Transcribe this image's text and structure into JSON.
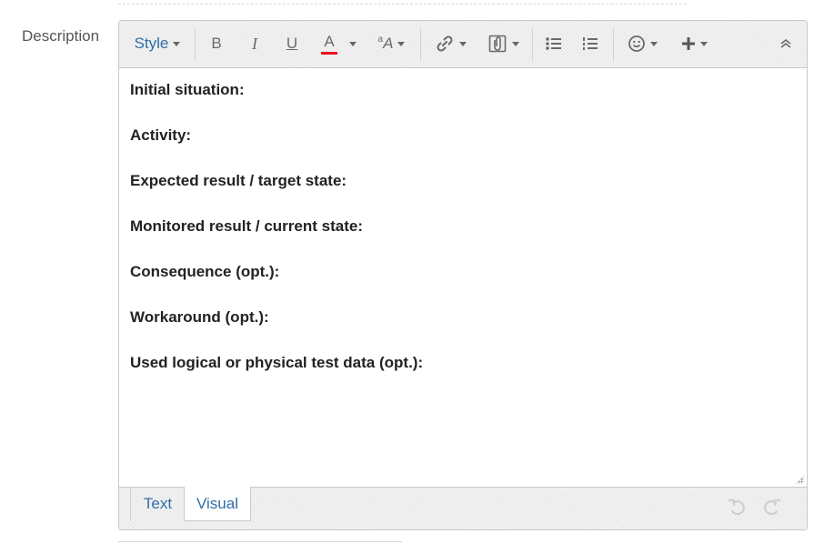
{
  "field": {
    "label": "Description"
  },
  "toolbar": {
    "style_label": "Style",
    "bold_label": "B",
    "italic_label": "I",
    "underline_label": "U",
    "font_color_label": "A",
    "font_color_accent": "#e8131d",
    "font_size_superscript": "a",
    "font_size_label": "A"
  },
  "content": {
    "lines": [
      "Initial situation:",
      "Activity:",
      "Expected result / target state:",
      "Monitored result / current state:",
      "Consequence (opt.):",
      "Workaround (opt.):",
      "Used logical or physical test data (opt.):"
    ]
  },
  "tabs": {
    "text_label": "Text",
    "visual_label": "Visual",
    "active": "Visual"
  },
  "colors": {
    "link_blue": "#2f6ea5",
    "toolbar_bg": "#f1f1f1",
    "border": "#c9c9c9",
    "icon_gray": "#6a6a6a"
  },
  "icons": {
    "toolbar": [
      "chevron-down-icon",
      "bold-icon",
      "italic-icon",
      "underline-icon",
      "font-color-icon",
      "font-size-icon",
      "link-icon",
      "attachment-icon",
      "bullet-list-icon",
      "numbered-list-icon",
      "emoji-icon",
      "plus-icon",
      "collapse-icon"
    ],
    "footer": [
      "undo-icon",
      "redo-icon",
      "resize-grip-icon"
    ]
  }
}
